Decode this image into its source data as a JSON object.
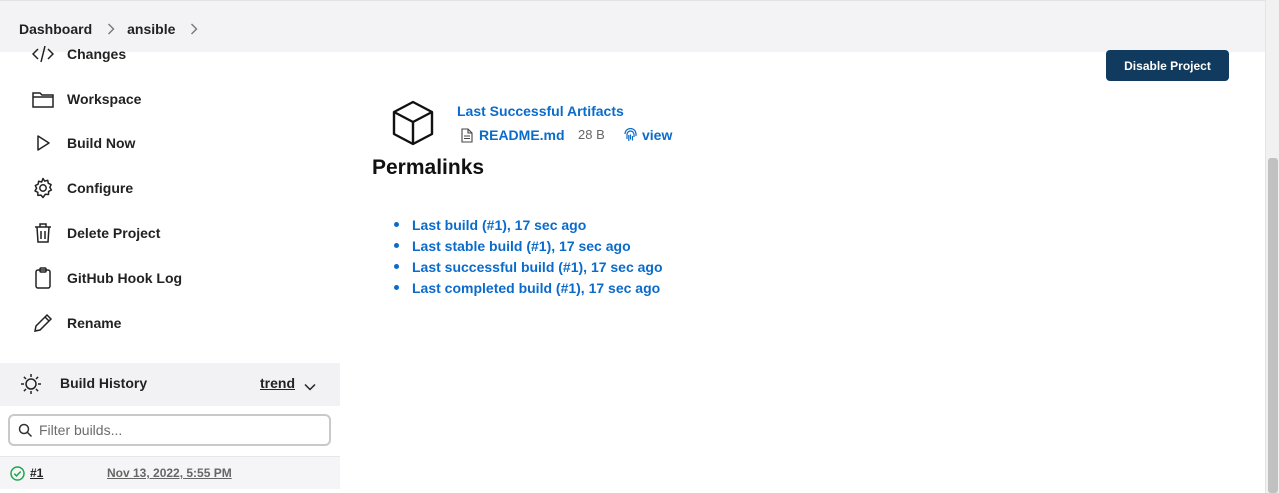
{
  "breadcrumb": {
    "items": [
      "Dashboard",
      "ansible"
    ]
  },
  "sidebar": {
    "tasks": [
      {
        "label": "Changes",
        "icon": "code-icon"
      },
      {
        "label": "Workspace",
        "icon": "folder-icon"
      },
      {
        "label": "Build Now",
        "icon": "play-icon"
      },
      {
        "label": "Configure",
        "icon": "gear-icon"
      },
      {
        "label": "Delete Project",
        "icon": "trash-icon"
      },
      {
        "label": "GitHub Hook Log",
        "icon": "clipboard-icon"
      },
      {
        "label": "Rename",
        "icon": "pencil-icon"
      }
    ]
  },
  "build_history": {
    "title": "Build History",
    "trend_label": "trend",
    "filter_placeholder": "Filter builds...",
    "builds": [
      {
        "number": "#1",
        "date": "Nov 13, 2022, 5:55 PM",
        "status": "success"
      }
    ]
  },
  "main": {
    "disable_button": "Disable Project",
    "artifacts": {
      "title": "Last Successful Artifacts",
      "files": [
        {
          "name": "README.md",
          "size": "28 B",
          "view_label": "view"
        }
      ]
    },
    "permalinks": {
      "title": "Permalinks",
      "links": [
        "Last build (#1), 17 sec ago",
        "Last stable build (#1), 17 sec ago",
        "Last successful build (#1), 17 sec ago",
        "Last completed build (#1), 17 sec ago"
      ]
    }
  },
  "colors": {
    "link": "#0b6bcb",
    "primary_button": "#113b5e",
    "success": "#1ea64b"
  }
}
